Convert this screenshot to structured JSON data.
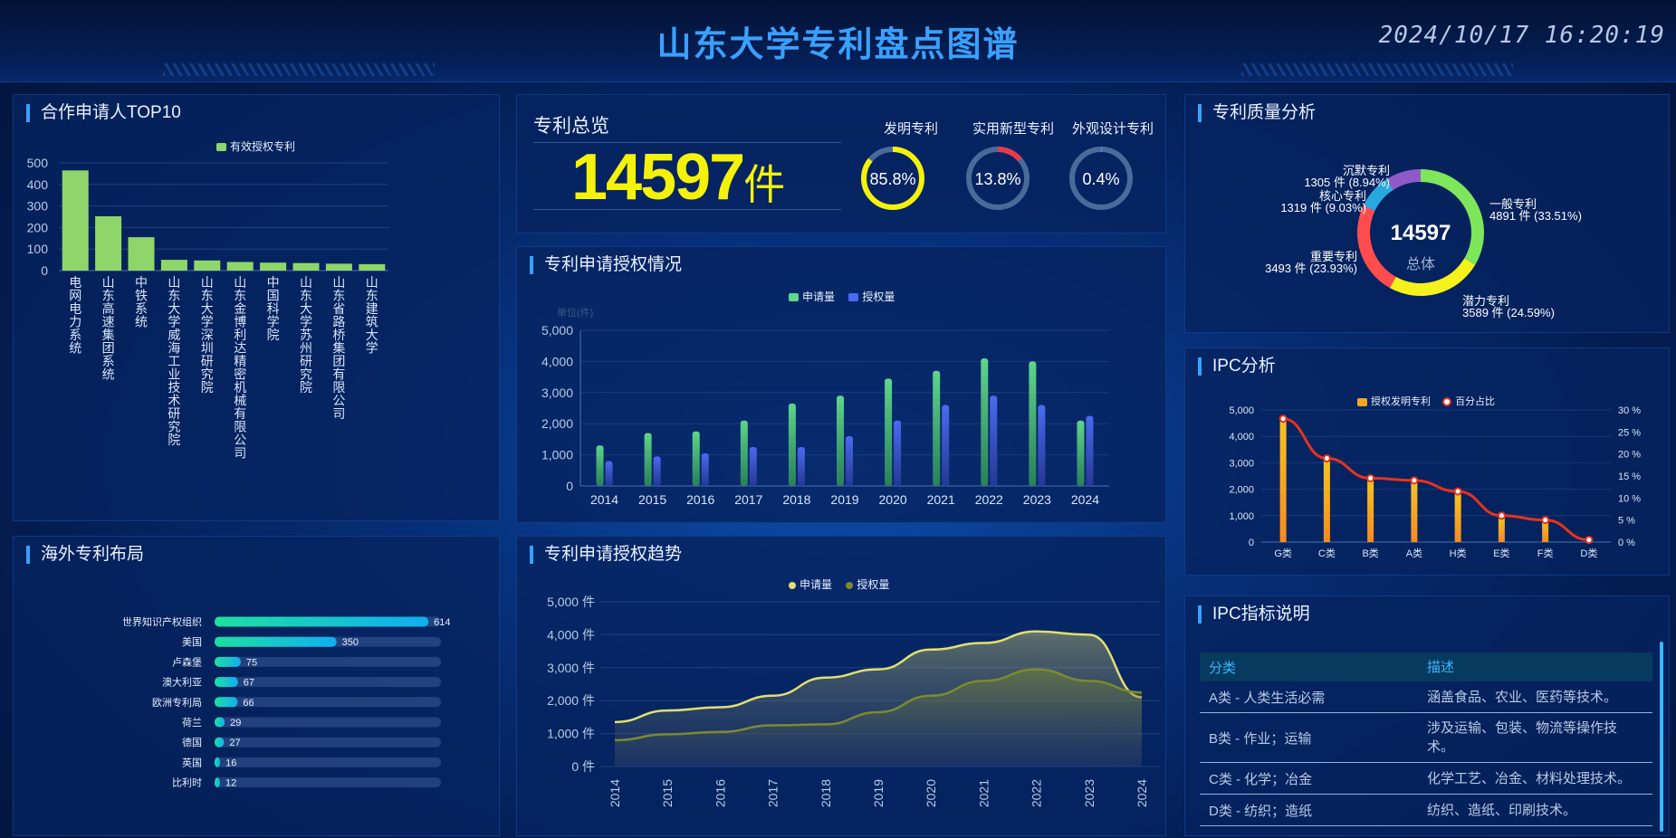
{
  "header": {
    "title": "山东大学专利盘点图谱",
    "datetime": "2024/10/17 16:20:19"
  },
  "panels": {
    "top10": "合作申请人TOP10",
    "overview": "专利总览",
    "quality": "专利质量分析",
    "grant": "专利申请授权情况",
    "ipc": "IPC分析",
    "overseas": "海外专利布局",
    "trend": "专利申请授权趋势",
    "ipc_desc": "IPC指标说明"
  },
  "overview": {
    "total": "14597",
    "unit": "件",
    "gauges": [
      {
        "label": "发明专利",
        "value": 85.8,
        "text": "85.8%",
        "color": "#f4f20a"
      },
      {
        "label": "实用新型专利",
        "value": 13.8,
        "text": "13.8%",
        "color": "#e83a4a"
      },
      {
        "label": "外观设计专利",
        "value": 0.4,
        "text": "0.4%",
        "color": "#3aa0ff"
      }
    ]
  },
  "chart_data": [
    {
      "id": "top10",
      "type": "bar",
      "legend": [
        "有效授权专利"
      ],
      "categories": [
        "电网电力系统",
        "山东高速集团系统",
        "中铁系统",
        "山东大学威海工业技术研究院",
        "山东大学深圳研究院",
        "山东金博利达精密机械有限公司",
        "中国科学院",
        "山东大学苏州研究院",
        "山东省路桥集团有限公司",
        "山东建筑大学"
      ],
      "series": [
        {
          "name": "有效授权专利",
          "values": [
            465,
            252,
            155,
            50,
            47,
            40,
            37,
            35,
            32,
            30
          ],
          "color": "#8fd66a"
        }
      ],
      "yticks": [
        "0",
        "100",
        "200",
        "300",
        "400",
        "500"
      ],
      "ylim": [
        0,
        500
      ]
    },
    {
      "id": "quality",
      "type": "pie",
      "center_value": "14597",
      "center_label": "总体",
      "slices": [
        {
          "name": "一般专利",
          "value": 4891,
          "text": "4891 件 (33.51%)",
          "color": "#7ee65a"
        },
        {
          "name": "潜力专利",
          "value": 3589,
          "text": "3589 件 (24.59%)",
          "color": "#f4f21a"
        },
        {
          "name": "重要专利",
          "value": 3493,
          "text": "3493 件 (23.93%)",
          "color": "#ff4d4f"
        },
        {
          "name": "核心专利",
          "value": 1319,
          "text": "1319 件 (9.03%)",
          "color": "#29a8e0"
        },
        {
          "name": "沉默专利",
          "value": 1305,
          "text": "1305 件 (8.94%)",
          "color": "#8e5ac8"
        }
      ]
    },
    {
      "id": "grant",
      "type": "bar",
      "legend": [
        "申请量",
        "授权量"
      ],
      "unit_label": "单位(件)",
      "categories": [
        "2014",
        "2015",
        "2016",
        "2017",
        "2018",
        "2019",
        "2020",
        "2021",
        "2022",
        "2023",
        "2024"
      ],
      "series": [
        {
          "name": "申请量",
          "values": [
            1300,
            1700,
            1750,
            2100,
            2650,
            2900,
            3450,
            3700,
            4100,
            4000,
            2100
          ],
          "color": "#5fd68a"
        },
        {
          "name": "授权量",
          "values": [
            800,
            950,
            1050,
            1250,
            1250,
            1600,
            2100,
            2600,
            2900,
            2600,
            2250
          ],
          "color": "#4a6cf0"
        }
      ],
      "yticks": [
        "0",
        "1,000",
        "2,000",
        "3,000",
        "4,000",
        "5,000"
      ],
      "ylim": [
        0,
        5000
      ]
    },
    {
      "id": "ipc",
      "type": "bar",
      "legend": [
        "授权发明专利",
        "百分占比"
      ],
      "categories": [
        "G类",
        "C类",
        "B类",
        "A类",
        "H类",
        "E类",
        "F类",
        "D类"
      ],
      "series": [
        {
          "name": "授权发明专利",
          "values": [
            4750,
            3050,
            2350,
            2300,
            1850,
            1000,
            900,
            100
          ],
          "color": "#f5a623"
        },
        {
          "name": "百分占比",
          "values": [
            28,
            19,
            14.5,
            14,
            11.5,
            6,
            5,
            0.5
          ],
          "color": "#e8321c"
        }
      ],
      "yticks": [
        "0",
        "1,000",
        "2,000",
        "3,000",
        "4,000",
        "5,000"
      ],
      "y2ticks": [
        "0 %",
        "5 %",
        "10 %",
        "15 %",
        "20 %",
        "25 %",
        "30 %"
      ],
      "ylim": [
        0,
        5000
      ],
      "y2lim": [
        0,
        30
      ]
    },
    {
      "id": "overseas",
      "type": "bar",
      "orientation": "horizontal",
      "categories": [
        "世界知识产权组织",
        "美国",
        "卢森堡",
        "澳大利亚",
        "欧洲专利局",
        "荷兰",
        "德国",
        "英国",
        "比利时"
      ],
      "values": [
        614,
        350,
        75,
        67,
        66,
        29,
        27,
        16,
        12
      ],
      "max": 650
    },
    {
      "id": "trend",
      "type": "area",
      "legend": [
        "申请量",
        "授权量"
      ],
      "categories": [
        "2014",
        "2015",
        "2016",
        "2017",
        "2018",
        "2019",
        "2020",
        "2021",
        "2022",
        "2023",
        "2024"
      ],
      "series": [
        {
          "name": "申请量",
          "values": [
            1350,
            1700,
            1800,
            2150,
            2700,
            2950,
            3550,
            3750,
            4100,
            4000,
            2100
          ],
          "color": "#e0e070"
        },
        {
          "name": "授权量",
          "values": [
            800,
            980,
            1050,
            1250,
            1280,
            1650,
            2150,
            2600,
            2950,
            2600,
            2250
          ],
          "color": "#7d8a2e"
        }
      ],
      "yticks": [
        "0 件",
        "1,000 件",
        "2,000 件",
        "3,000 件",
        "4,000 件",
        "5,000 件"
      ],
      "ylim": [
        0,
        5000
      ]
    }
  ],
  "ipc_desc": {
    "headers": [
      "分类",
      "描述"
    ],
    "rows": [
      {
        "cat": "A类 - 人类生活必需",
        "desc": "涵盖食品、农业、医药等技术。"
      },
      {
        "cat": "B类 - 作业；运输",
        "desc": "涉及运输、包装、物流等操作技术。"
      },
      {
        "cat": "C类 - 化学；冶金",
        "desc": "化学工艺、冶金、材料处理技术。"
      },
      {
        "cat": "D类 - 纺织；造纸",
        "desc": "纺织、造纸、印刷技术。"
      }
    ]
  }
}
